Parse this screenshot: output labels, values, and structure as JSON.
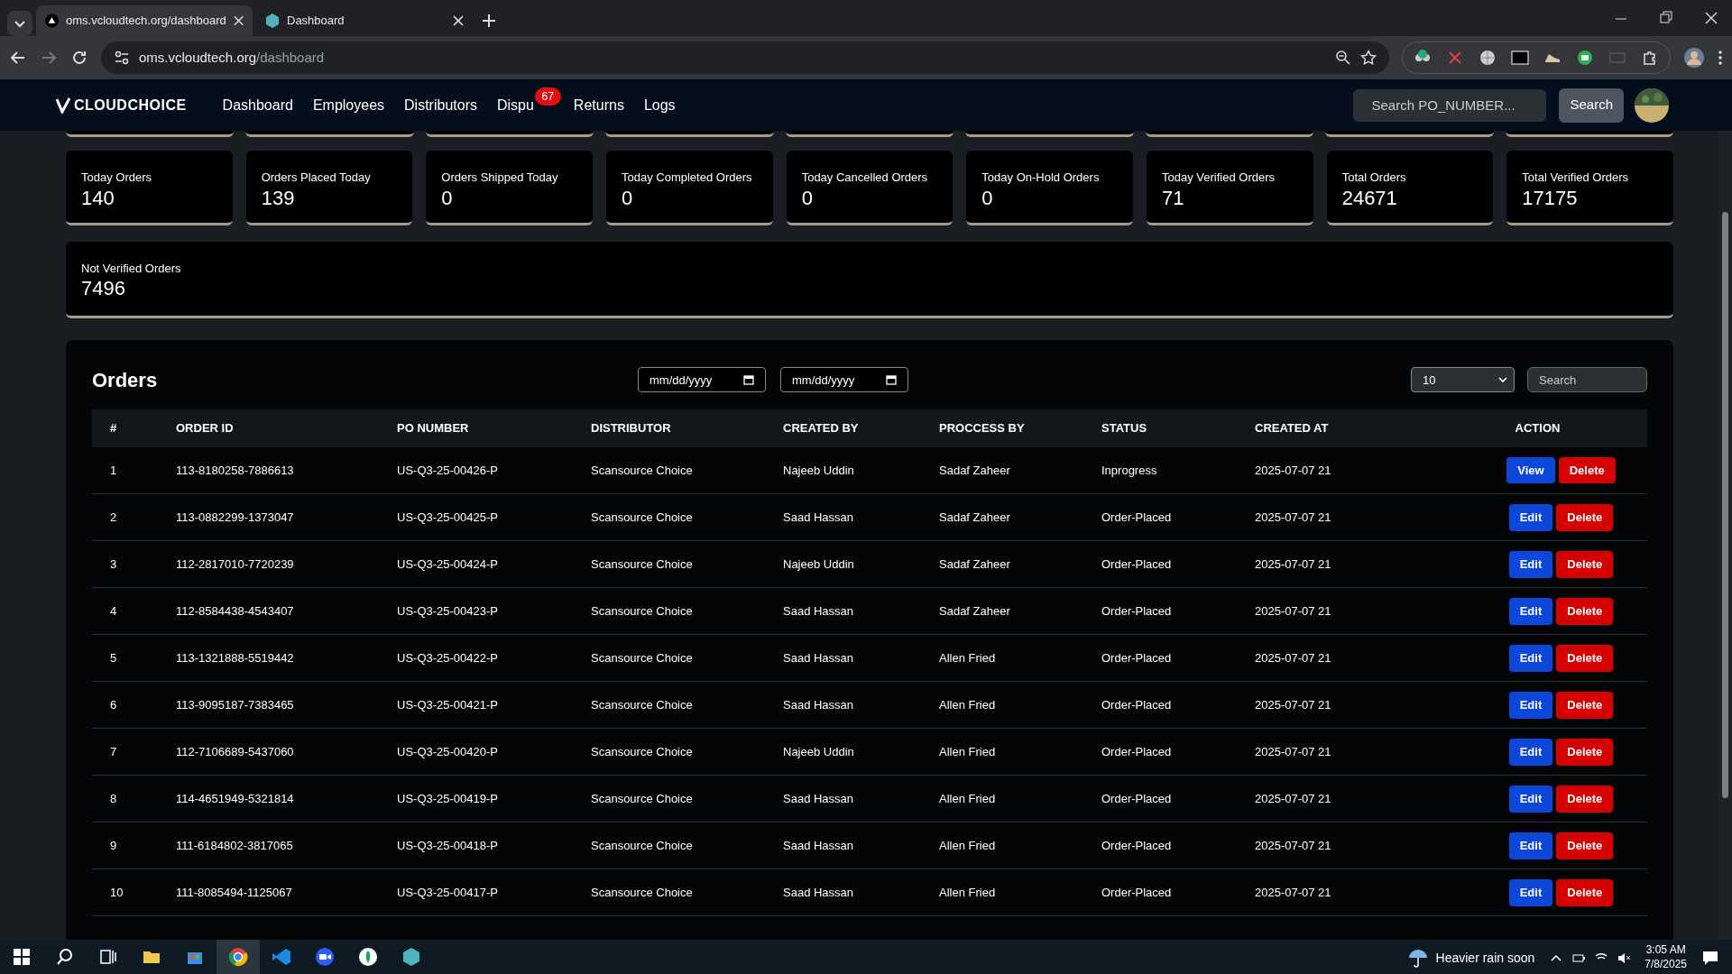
{
  "browser": {
    "tabs": [
      {
        "title": "oms.vcloudtech.org/dashboard",
        "selected": true,
        "kind": "triangle"
      },
      {
        "title": "Dashboard",
        "selected": false,
        "kind": "hex"
      }
    ],
    "address": {
      "host": "oms.vcloudtech.org",
      "path": "/dashboard"
    }
  },
  "navbar": {
    "logo": "CLOUDCHOICE",
    "items": [
      {
        "label": "Dashboard"
      },
      {
        "label": "Employees"
      },
      {
        "label": "Distributors"
      },
      {
        "label": "Dispu",
        "badge": "67"
      },
      {
        "label": "Returns"
      },
      {
        "label": "Logs"
      }
    ],
    "search": {
      "placeholder": "Search PO_NUMBER..."
    },
    "search_button": "Search"
  },
  "stats": [
    {
      "label": "Today Orders",
      "value": "140"
    },
    {
      "label": "Orders Placed Today",
      "value": "139"
    },
    {
      "label": "Orders Shipped Today",
      "value": "0"
    },
    {
      "label": "Today Completed Orders",
      "value": "0"
    },
    {
      "label": "Today Cancelled Orders",
      "value": "0"
    },
    {
      "label": "Today On-Hold Orders",
      "value": "0"
    },
    {
      "label": "Today Verified Orders",
      "value": "71"
    },
    {
      "label": "Total Orders",
      "value": "24671"
    },
    {
      "label": "Total Verified Orders",
      "value": "17175"
    },
    {
      "label": "Not Verified Orders",
      "value": "7496"
    }
  ],
  "orders": {
    "title": "Orders",
    "date_from": "mm/dd/yyyy",
    "date_to": "mm/dd/yyyy",
    "page_size": "10",
    "search": {
      "placeholder": "Search"
    },
    "columns": [
      "#",
      "ORDER ID",
      "PO NUMBER",
      "DISTRIBUTOR",
      "CREATED BY",
      "PROCCESS BY",
      "STATUS",
      "CREATED AT",
      "ACTION"
    ],
    "rows": [
      {
        "cells": [
          "1",
          "113-8180258-7886613",
          "US-Q3-25-00426-P",
          "Scansource Choice",
          "Najeeb Uddin",
          "Sadaf Zaheer",
          "Inprogress",
          "2025-07-07 21"
        ],
        "actions": [
          {
            "label": "View",
            "kind": "view"
          },
          {
            "label": "Delete",
            "kind": "delete"
          }
        ]
      },
      {
        "cells": [
          "2",
          "113-0882299-1373047",
          "US-Q3-25-00425-P",
          "Scansource Choice",
          "Saad Hassan",
          "Sadaf Zaheer",
          "Order-Placed",
          "2025-07-07 21"
        ],
        "actions": [
          {
            "label": "Edit",
            "kind": "edit"
          },
          {
            "label": "Delete",
            "kind": "delete"
          }
        ]
      },
      {
        "cells": [
          "3",
          "112-2817010-7720239",
          "US-Q3-25-00424-P",
          "Scansource Choice",
          "Najeeb Uddin",
          "Sadaf Zaheer",
          "Order-Placed",
          "2025-07-07 21"
        ],
        "actions": [
          {
            "label": "Edit",
            "kind": "edit"
          },
          {
            "label": "Delete",
            "kind": "delete"
          }
        ]
      },
      {
        "cells": [
          "4",
          "112-8584438-4543407",
          "US-Q3-25-00423-P",
          "Scansource Choice",
          "Saad Hassan",
          "Sadaf Zaheer",
          "Order-Placed",
          "2025-07-07 21"
        ],
        "actions": [
          {
            "label": "Edit",
            "kind": "edit"
          },
          {
            "label": "Delete",
            "kind": "delete"
          }
        ]
      },
      {
        "cells": [
          "5",
          "113-1321888-5519442",
          "US-Q3-25-00422-P",
          "Scansource Choice",
          "Saad Hassan",
          "Allen Fried",
          "Order-Placed",
          "2025-07-07 21"
        ],
        "actions": [
          {
            "label": "Edit",
            "kind": "edit"
          },
          {
            "label": "Delete",
            "kind": "delete"
          }
        ]
      },
      {
        "cells": [
          "6",
          "113-9095187-7383465",
          "US-Q3-25-00421-P",
          "Scansource Choice",
          "Saad Hassan",
          "Allen Fried",
          "Order-Placed",
          "2025-07-07 21"
        ],
        "actions": [
          {
            "label": "Edit",
            "kind": "edit"
          },
          {
            "label": "Delete",
            "kind": "delete"
          }
        ]
      },
      {
        "cells": [
          "7",
          "112-7106689-5437060",
          "US-Q3-25-00420-P",
          "Scansource Choice",
          "Najeeb Uddin",
          "Allen Fried",
          "Order-Placed",
          "2025-07-07 21"
        ],
        "actions": [
          {
            "label": "Edit",
            "kind": "edit"
          },
          {
            "label": "Delete",
            "kind": "delete"
          }
        ]
      },
      {
        "cells": [
          "8",
          "114-4651949-5321814",
          "US-Q3-25-00419-P",
          "Scansource Choice",
          "Saad Hassan",
          "Allen Fried",
          "Order-Placed",
          "2025-07-07 21"
        ],
        "actions": [
          {
            "label": "Edit",
            "kind": "edit"
          },
          {
            "label": "Delete",
            "kind": "delete"
          }
        ]
      },
      {
        "cells": [
          "9",
          "111-6184802-3817065",
          "US-Q3-25-00418-P",
          "Scansource Choice",
          "Saad Hassan",
          "Allen Fried",
          "Order-Placed",
          "2025-07-07 21"
        ],
        "actions": [
          {
            "label": "Edit",
            "kind": "edit"
          },
          {
            "label": "Delete",
            "kind": "delete"
          }
        ]
      },
      {
        "cells": [
          "10",
          "111-8085494-1125067",
          "US-Q3-25-00417-P",
          "Scansource Choice",
          "Saad Hassan",
          "Allen Fried",
          "Order-Placed",
          "2025-07-07 21"
        ],
        "actions": [
          {
            "label": "Edit",
            "kind": "edit"
          },
          {
            "label": "Delete",
            "kind": "delete"
          }
        ]
      }
    ]
  },
  "taskbar": {
    "apps": [
      {
        "kind": "explorer",
        "selected": false
      },
      {
        "kind": "store",
        "selected": false
      },
      {
        "kind": "chrome",
        "selected": true
      },
      {
        "kind": "vscode",
        "selected": false
      },
      {
        "kind": "zoom",
        "selected": false
      },
      {
        "kind": "leaf",
        "selected": false
      },
      {
        "kind": "hex",
        "selected": false
      }
    ],
    "weather": "Heavier rain soon",
    "time": "3:05 AM",
    "date": "7/8/2025"
  }
}
